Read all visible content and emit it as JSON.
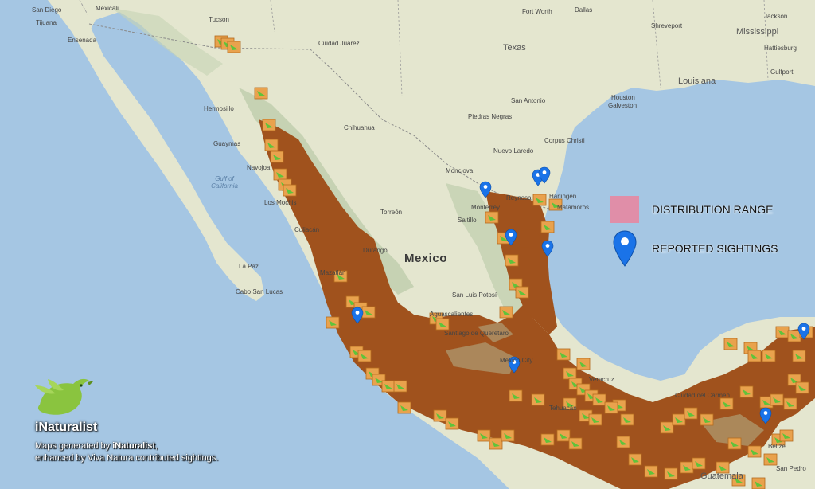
{
  "map": {
    "country_label": "Mexico",
    "place_labels": {
      "san_diego": "San Diego",
      "tijuana": "Tijuana",
      "mexicali": "Mexicali",
      "ensenada": "Ensenada",
      "tucson": "Tucson",
      "hermosillo": "Hermosillo",
      "guaymas": "Guaymas",
      "navojoa": "Navojoa",
      "los_mochis": "Los Mochis",
      "culiacan": "Culiacán",
      "la_paz": "La Paz",
      "cabo_san_lucas": "Cabo San Lucas",
      "ciudad_juarez": "Ciudad Juarez",
      "chihuahua": "Chihuahua",
      "torreon": "Torreón",
      "durango": "Durango",
      "mazatlan": "Mazatlán",
      "monclova": "Monclova",
      "saltillo": "Saltillo",
      "monterrey": "Monterrey",
      "reynosa": "Reynosa",
      "matamoros": "Matamoros",
      "nuevo_laredo": "Nuevo Laredo",
      "piedras_negras": "Piedras Negras",
      "san_luis_potosi": "San Luis Potosí",
      "aguascalientes": "Aguascalientes",
      "queretaro": "Santiago de Querétaro",
      "mexico_city": "Mexico City",
      "veracruz": "Veracruz",
      "tehuacan": "Tehuacán",
      "ciudad_del_carmen": "Ciudad del Carmen",
      "san_pedro": "San Pedro",
      "guatemala": "Guatemala",
      "belize": "Belize",
      "texas": "Texas",
      "louisiana": "Louisiana",
      "mississippi": "Mississippi",
      "fort_worth": "Fort Worth",
      "dallas": "Dallas",
      "houston": "Houston",
      "san_antonio": "San Antonio",
      "corpus_christi": "Corpus Christi",
      "galveston": "Galveston",
      "shreveport": "Shreveport",
      "jackson": "Jackson",
      "hattiesburg": "Hattiesburg",
      "gulfport": "Gulfport",
      "harlingen": "Harlingen",
      "gulf_of_california": "Gulf of California"
    }
  },
  "legend": {
    "distribution_label": "DISTRIBUTION RANGE",
    "sightings_label": "REPORTED SIGHTINGS",
    "distribution_color": "#e08ea8",
    "sightings_color": "#1a73e8"
  },
  "branding": {
    "logo_text": "iNaturalist",
    "credit_line1_prefix": "Maps generated by ",
    "credit_line1_brand": "iNaturalist",
    "credit_line1_suffix": ",",
    "credit_line2": "enhanced by Viva Natura contributed sightings."
  },
  "colors": {
    "ocean": "#a5c6e3",
    "land": "#e4e6cf",
    "mountains": "#b9c9a6",
    "range": "#a0521d",
    "observation_box": "#e9a24d",
    "observation_leaf": "#5fc33b"
  }
}
